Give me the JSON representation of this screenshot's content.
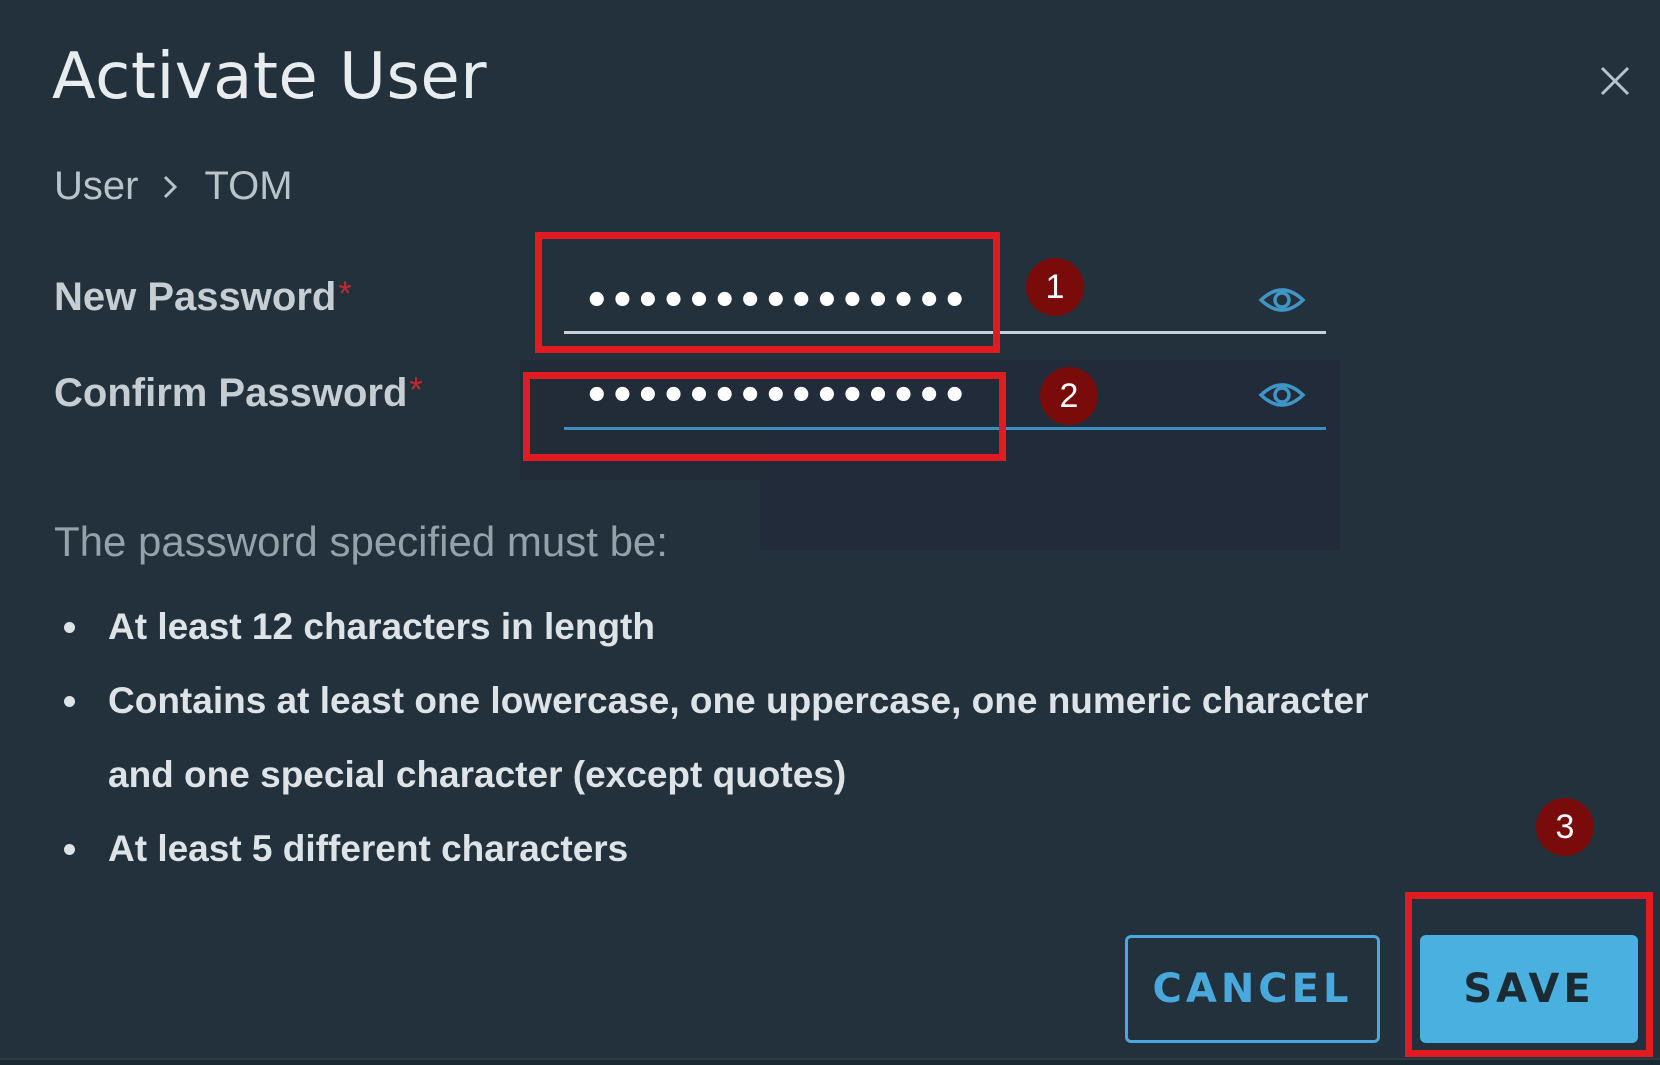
{
  "dialog": {
    "title": "Activate User",
    "close_icon": "close-icon"
  },
  "breadcrumb": {
    "items": [
      "User",
      "TOM"
    ],
    "separator_icon": "chevron-right-icon"
  },
  "form": {
    "new_password": {
      "label": "New Password",
      "required_mark": "*",
      "value": "•••••••••••••••",
      "reveal_icon": "eye-icon"
    },
    "confirm_password": {
      "label": "Confirm Password",
      "required_mark": "*",
      "value": "•••••••••••••••",
      "reveal_icon": "eye-icon"
    }
  },
  "requirements": {
    "intro": "The password specified must be:",
    "items": [
      "At least 12 characters in length",
      "Contains at least one lowercase, one uppercase, one numeric character and one special character (except quotes)",
      "At least 5 different characters"
    ]
  },
  "actions": {
    "cancel_label": "CANCEL",
    "save_label": "SAVE"
  },
  "annotations": {
    "markers": [
      "1",
      "2",
      "3"
    ],
    "highlight_color": "#e11b22",
    "marker_color": "#7a0b0b"
  },
  "colors": {
    "background": "#22313b",
    "accent": "#49b0e0",
    "required": "#c8262e"
  }
}
